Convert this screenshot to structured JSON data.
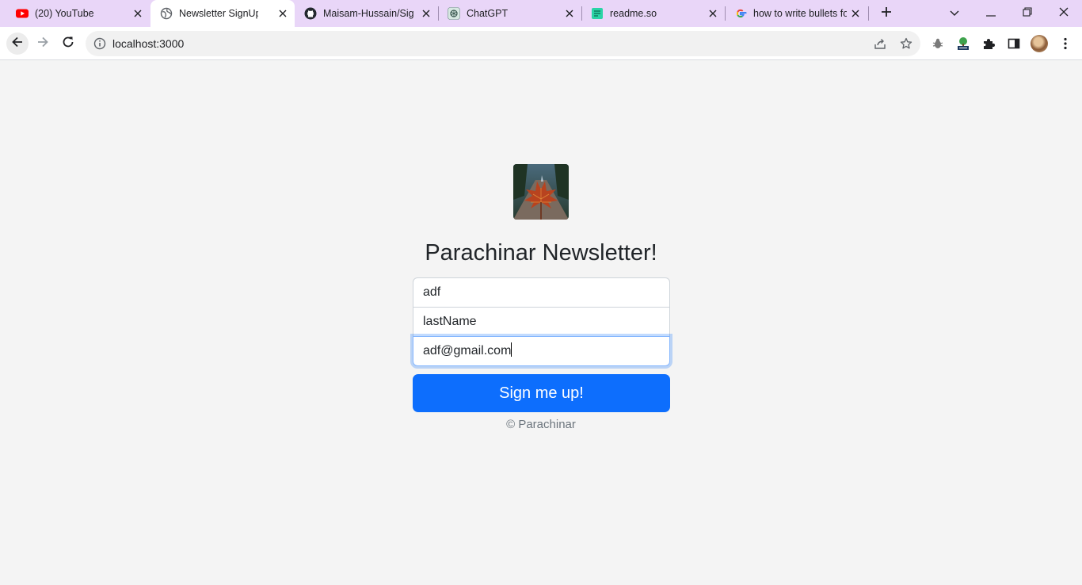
{
  "browser": {
    "tabs": [
      {
        "title": "(20) YouTube",
        "icon": "youtube-icon",
        "active": false
      },
      {
        "title": "Newsletter SignUp",
        "icon": "globe-icon",
        "active": true
      },
      {
        "title": "Maisam-Hussain/Sign",
        "icon": "github-icon",
        "active": false
      },
      {
        "title": "ChatGPT",
        "icon": "chatgpt-icon",
        "active": false
      },
      {
        "title": "readme.so",
        "icon": "readme-icon",
        "active": false
      },
      {
        "title": "how to write bullets fo",
        "icon": "google-icon",
        "active": false
      }
    ],
    "url": "localhost:3000",
    "accent_color": "#e9d6f8"
  },
  "page": {
    "logo_icon": "maple-leaf-photo",
    "heading": "Parachinar Newsletter!",
    "form": {
      "first_name_value": "adf",
      "last_name_placeholder": "lastName",
      "email_value": "adf@gmail.com"
    },
    "button_label": "Sign me up!",
    "button_color": "#0d6efd",
    "footer": "© Parachinar"
  }
}
